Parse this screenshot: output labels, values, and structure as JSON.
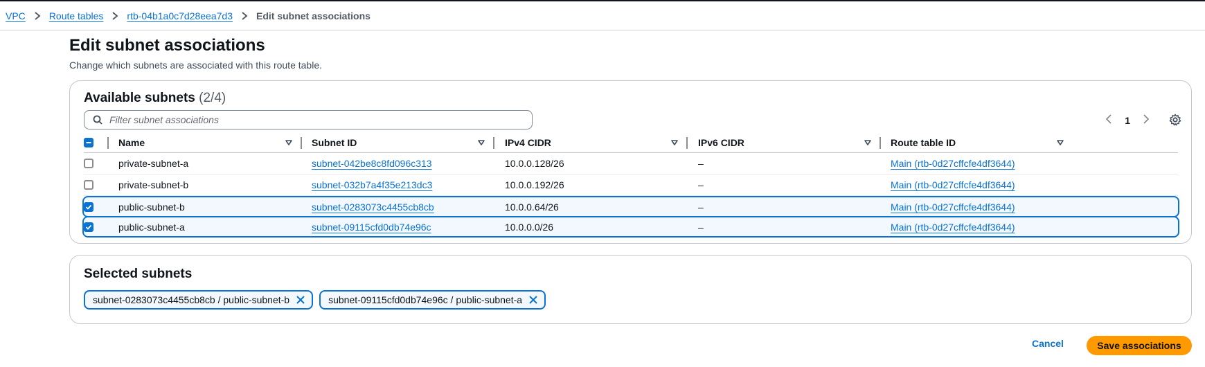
{
  "breadcrumb": {
    "items": [
      {
        "label": "VPC"
      },
      {
        "label": "Route tables"
      },
      {
        "label": "rtb-04b1a0c7d28eea7d3"
      }
    ],
    "current": "Edit subnet associations"
  },
  "page": {
    "title": "Edit subnet associations",
    "description": "Change which subnets are associated with this route table."
  },
  "available": {
    "title": "Available subnets",
    "count": "(2/4)",
    "filter_placeholder": "Filter subnet associations",
    "filter_value": "",
    "page_number": "1",
    "columns": [
      "Name",
      "Subnet ID",
      "IPv4 CIDR",
      "IPv6 CIDR",
      "Route table ID"
    ],
    "rows": [
      {
        "checked": false,
        "name": "private-subnet-a",
        "subnet_id": "subnet-042be8c8fd096c313",
        "ipv4": "10.0.0.128/26",
        "ipv6": "–",
        "route_table": "Main (rtb-0d27cffcfe4df3644)"
      },
      {
        "checked": false,
        "name": "private-subnet-b",
        "subnet_id": "subnet-032b7a4f35e213dc3",
        "ipv4": "10.0.0.192/26",
        "ipv6": "–",
        "route_table": "Main (rtb-0d27cffcfe4df3644)"
      },
      {
        "checked": true,
        "name": "public-subnet-b",
        "subnet_id": "subnet-0283073c4455cb8cb",
        "ipv4": "10.0.0.64/26",
        "ipv6": "–",
        "route_table": "Main (rtb-0d27cffcfe4df3644)"
      },
      {
        "checked": true,
        "name": "public-subnet-a",
        "subnet_id": "subnet-09115cfd0db74e96c",
        "ipv4": "10.0.0.0/26",
        "ipv6": "–",
        "route_table": "Main (rtb-0d27cffcfe4df3644)"
      }
    ]
  },
  "selected": {
    "title": "Selected subnets",
    "tokens": [
      {
        "label": "subnet-0283073c4455cb8cb / public-subnet-b"
      },
      {
        "label": "subnet-09115cfd0db74e96c / public-subnet-a"
      }
    ]
  },
  "footer": {
    "cancel_label": "Cancel",
    "save_label": "Save associations"
  },
  "colors": {
    "link": "#0972d3",
    "primary_button": "#ff9900",
    "selected_row_bg": "#f2f8fd"
  },
  "icons": [
    "chevron-right-icon",
    "search-icon",
    "chevron-left-icon",
    "settings-gear-icon",
    "sort-caret-icon",
    "checkbox-icon",
    "close-icon"
  ]
}
